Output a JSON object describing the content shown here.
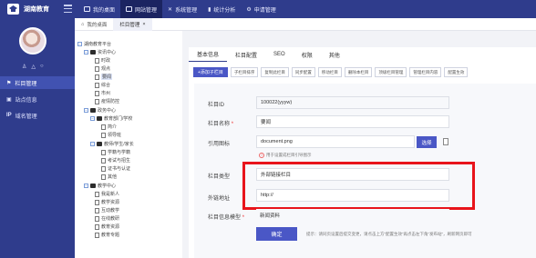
{
  "brand": {
    "name": "湖南教育"
  },
  "topnav": [
    {
      "label": "我的桌面",
      "icon": "monitor-icon"
    },
    {
      "label": "网站管理",
      "icon": "site-icon",
      "active": true
    },
    {
      "label": "系统管理",
      "icon": "tools-icon"
    },
    {
      "label": "统计分析",
      "icon": "chart-icon"
    },
    {
      "label": "申请管理",
      "icon": "gear-icon"
    }
  ],
  "sidebar": {
    "user_icons": [
      "user-icon",
      "bell-icon",
      "power-icon"
    ],
    "items": [
      {
        "label": "栏目管理",
        "active": true
      },
      {
        "label": "站点信息"
      },
      {
        "label": "域名管理",
        "prefix": "IP"
      }
    ]
  },
  "tabs": [
    {
      "label": "我的桌面"
    },
    {
      "label": "栏目管理",
      "active": true,
      "close": "×"
    }
  ],
  "tree": {
    "nodes": [
      {
        "label": "湖南教育平台",
        "type": "box"
      },
      {
        "label": "资讯中心",
        "type": "folder"
      },
      {
        "label": "时政",
        "type": "file"
      },
      {
        "label": "观点",
        "type": "file"
      },
      {
        "label": "要闻",
        "type": "file",
        "highlight": true
      },
      {
        "label": "综合",
        "type": "file"
      },
      {
        "label": "市州",
        "type": "file"
      },
      {
        "label": "疫情防控",
        "type": "file"
      },
      {
        "label": "政务中心",
        "type": "folder"
      },
      {
        "label": "教育部门/学校",
        "type": "folder"
      },
      {
        "label": "简介",
        "type": "file"
      },
      {
        "label": "领导班",
        "type": "file"
      },
      {
        "label": "教师/学生/家长",
        "type": "folder"
      },
      {
        "label": "学籍与学籍",
        "type": "file"
      },
      {
        "label": "考试与招生",
        "type": "file"
      },
      {
        "label": "证书与认证",
        "type": "file"
      },
      {
        "label": "其他",
        "type": "file"
      },
      {
        "label": "教学中心",
        "type": "folder"
      },
      {
        "label": "我是新人",
        "type": "file"
      },
      {
        "label": "教学资源",
        "type": "file"
      },
      {
        "label": "互动教学",
        "type": "file"
      },
      {
        "label": "在线教研",
        "type": "file"
      },
      {
        "label": "教育资源",
        "type": "file"
      },
      {
        "label": "教育专题",
        "type": "file"
      }
    ]
  },
  "content_tabs": [
    {
      "label": "基本信息",
      "active": true
    },
    {
      "label": "栏目配置"
    },
    {
      "label": "SEO"
    },
    {
      "label": "权限"
    },
    {
      "label": "其他"
    }
  ],
  "toolbar": [
    {
      "label": "+添加子栏目",
      "primary": true
    },
    {
      "label": "子栏目排序"
    },
    {
      "label": "复制此栏目"
    },
    {
      "label": "同步配置"
    },
    {
      "label": "移动栏目"
    },
    {
      "label": "删除本栏目"
    },
    {
      "label": "顶级栏目管理"
    },
    {
      "label": "管理栏目内容"
    },
    {
      "label": "配置生效"
    }
  ],
  "form": {
    "id_label": "栏目ID",
    "id_value": "100022(yyyw)",
    "name_label": "栏目名称",
    "name_required": "*",
    "name_value": "要闻",
    "icon_label": "引用图标",
    "icon_value": "document.png",
    "select_button": "选择",
    "hint_icon": "!",
    "hint": "用于设置成栏目引导图示",
    "type_label": "栏目类型",
    "type_value": "外部链接栏目",
    "url_label": "外链地址",
    "url_value": "http://",
    "tpl_label": "栏目信息模型",
    "tpl_required": "*",
    "tpl_value": "新闻资料",
    "confirm": "确定",
    "note": "提示：请同页设置后提交变更，请点击上方“配置生效”再点击左下角“发布站”，刷新网页即可"
  }
}
